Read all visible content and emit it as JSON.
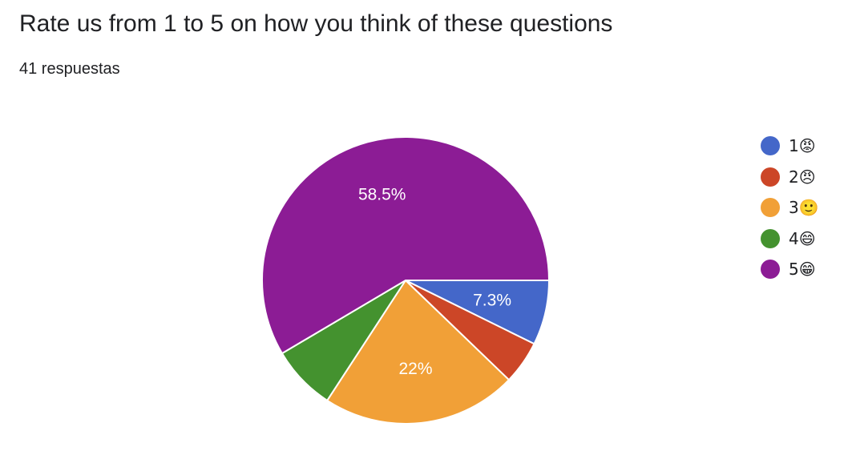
{
  "header": {
    "title": "Rate us from 1 to 5 on how you think of these questions",
    "responses": "41 respuestas"
  },
  "chart_data": {
    "type": "pie",
    "title": "Rate us from 1 to 5 on how you think of these questions",
    "total_responses": 41,
    "categories": [
      "1😡",
      "2😠",
      "3🙂",
      "4😄",
      "5😁"
    ],
    "values": [
      7.3,
      4.9,
      22,
      7.3,
      58.5
    ],
    "counts": [
      3,
      2,
      9,
      3,
      24
    ],
    "colors": [
      "#4467c9",
      "#cc4627",
      "#f1a037",
      "#44922f",
      "#8c1c95"
    ],
    "data_labels": [
      "7.3%",
      "",
      "22%",
      "",
      "58.5%"
    ],
    "legend_position": "right"
  }
}
